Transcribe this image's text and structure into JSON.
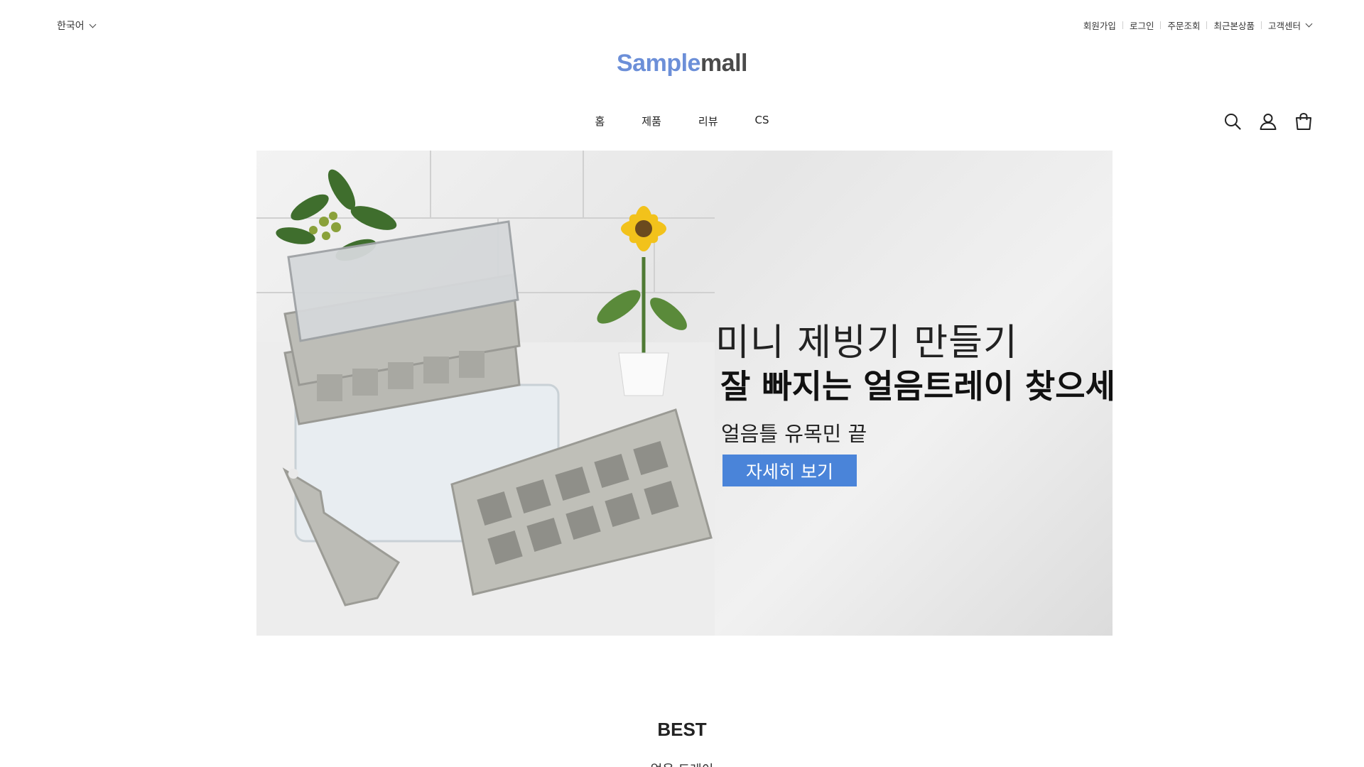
{
  "topbar": {
    "language": "한국어",
    "links": [
      "회원가입",
      "로그인",
      "주문조회",
      "최근본상품"
    ],
    "customer_center": "고객센터"
  },
  "logo": {
    "part1": "Sample",
    "part2": "mall",
    "color1": "#6c8fd8",
    "color2": "#4a4a4a"
  },
  "nav": {
    "items": [
      "홈",
      "제품",
      "리뷰",
      "CS"
    ]
  },
  "header_icons": [
    "search-icon",
    "user-icon",
    "cart-icon"
  ],
  "hero": {
    "line1": "미니 제빙기 만들기",
    "line2": "잘 빠지는 얼음트레이 찾으세요?",
    "line3": "얼음틀 유목민 끝",
    "button": "자세히 보기",
    "button_color": "#4a84d9"
  },
  "best": {
    "title": "BEST",
    "subtitle": "얼음 트레이"
  }
}
